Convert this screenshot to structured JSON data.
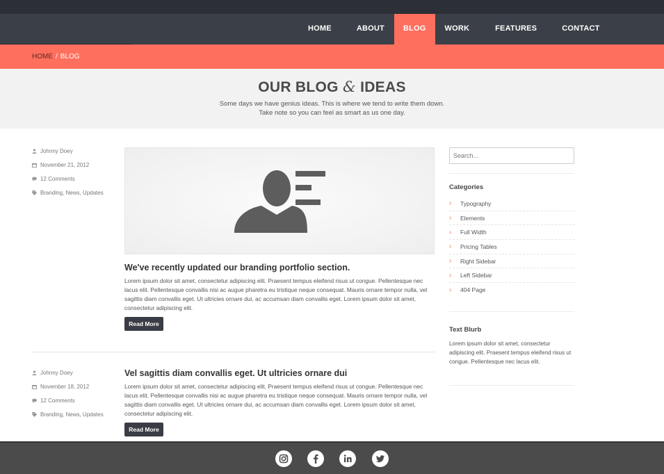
{
  "nav": {
    "items": [
      "HOME",
      "ABOUT",
      "BLOG",
      "WORK",
      "FEATURES",
      "CONTACT"
    ],
    "active": "BLOG"
  },
  "breadcrumb": {
    "home": "HOME",
    "separator": "/",
    "current": "BLOG"
  },
  "hero": {
    "title_part1": "OUR BLOG",
    "title_amp": "&",
    "title_part2": "IDEAS",
    "subtitle_line1": "Some days we have genius ideas. This is where we tend to write them down.",
    "subtitle_line2": "Take note so you can feel as smart as us one day."
  },
  "posts": [
    {
      "author": "Johnny Doey",
      "date": "November 21, 2012",
      "comments": "12 Comments",
      "tags": "Branding, News, Updates",
      "title": "We've recently updated our branding portfolio section.",
      "body": "Lorem ipsum dolor sit amet, consectetur adipiscing elit. Praesent tempus eleifend risus ut congue. Pellentesque nec lacus elit. Pellentesque convallis nisi ac augue pharetra eu tristique neque consequat. Mauris ornare tempor nulla, vel sagittis diam convallis eget. Ut ultricies ornare dui, ac accumsan diam convallis eget. Lorem ipsum dolor sit amet, consectetur adipiscing elit.",
      "read_more": "Read More"
    },
    {
      "author": "Johnny Doey",
      "date": "November 18, 2012",
      "comments": "12 Comments",
      "tags": "Branding, News, Updates",
      "title": "Vel sagittis diam convallis eget. Ut ultricies ornare dui",
      "body": "Lorem ipsum dolor sit amet, consectetur adipiscing elit. Praesent tempus eleifend risus ut congue. Pellentesque nec lacus elit. Pellentesque convallis nisi ac augue pharetra eu tristique neque consequat. Mauris ornare tempor nulla, vel sagittis diam convallis eget. Ut ultricies ornare dui, ac accumsan diam convallis eget. Lorem ipsum dolor sit amet, consectetur adipiscing elit.",
      "read_more": "Read More"
    }
  ],
  "sidebar": {
    "search_placeholder": "Search...",
    "categories_title": "Categories",
    "categories": [
      "Typography",
      "Elements",
      "Full Width",
      "Pricing Tables",
      "Right Sidebar",
      "Left Sidebar",
      "404 Page"
    ],
    "blurb_title": "Text Blurb",
    "blurb_text": "Lorem ipsum dolor sit amet, consectetur adipiscing elit. Praesent tempus eleifend risus ut congue. Pellentesque nec lacus elit."
  },
  "footer": {
    "social_icons": [
      "instagram-icon",
      "facebook-icon",
      "linkedin-icon",
      "twitter-icon"
    ]
  },
  "colors": {
    "accent": "#ff6f5e",
    "nav_bg": "#3b3f48",
    "topbar_bg": "#2c2f36",
    "button_bg": "#3a3d45",
    "footer_bg": "#4b4b4b"
  }
}
